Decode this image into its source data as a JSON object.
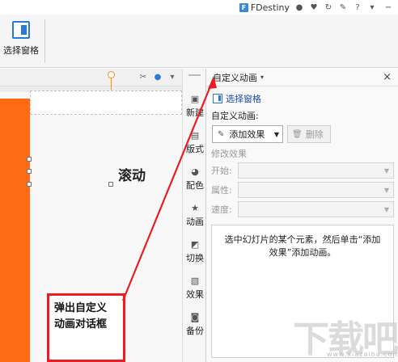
{
  "titlebar": {
    "app_name": "FDestiny",
    "help": "?",
    "caret": "▾"
  },
  "ribbon": {
    "selection_pane_label": "选择窗格"
  },
  "slide": {
    "text": "滚动"
  },
  "annotation": {
    "lines": [
      "弹出自定义",
      "动画对话框"
    ]
  },
  "side_strip": {
    "items": [
      {
        "label": "新建",
        "icon": "new-slide-icon"
      },
      {
        "label": "版式",
        "icon": "layout-icon"
      },
      {
        "label": "配色",
        "icon": "color-scheme-icon"
      },
      {
        "label": "动画",
        "icon": "animation-icon"
      },
      {
        "label": "切换",
        "icon": "transition-icon"
      },
      {
        "label": "效果",
        "icon": "effects-icon"
      },
      {
        "label": "备份",
        "icon": "backup-icon"
      }
    ]
  },
  "panel": {
    "title": "自定义动画",
    "caret": "▾",
    "close": "×",
    "selection_pane_link": "选择窗格",
    "custom_animation_label": "自定义动画:",
    "add_effect_label": "添加效果",
    "delete_label": "删除",
    "modify_effect_label": "修改效果",
    "fields": [
      {
        "label": "开始:",
        "value": ""
      },
      {
        "label": "属性:",
        "value": ""
      },
      {
        "label": "速度:",
        "value": ""
      }
    ],
    "info_text": "选中幻灯片的某个元素，然后单击“添加效果”添加动画。"
  },
  "watermark": {
    "text": "下载吧",
    "sub": "www.xiazaiba.com"
  },
  "colors": {
    "accent": "#2b7bd5",
    "slide_orange": "#ff6a13",
    "callout_red": "#ea1c24"
  }
}
